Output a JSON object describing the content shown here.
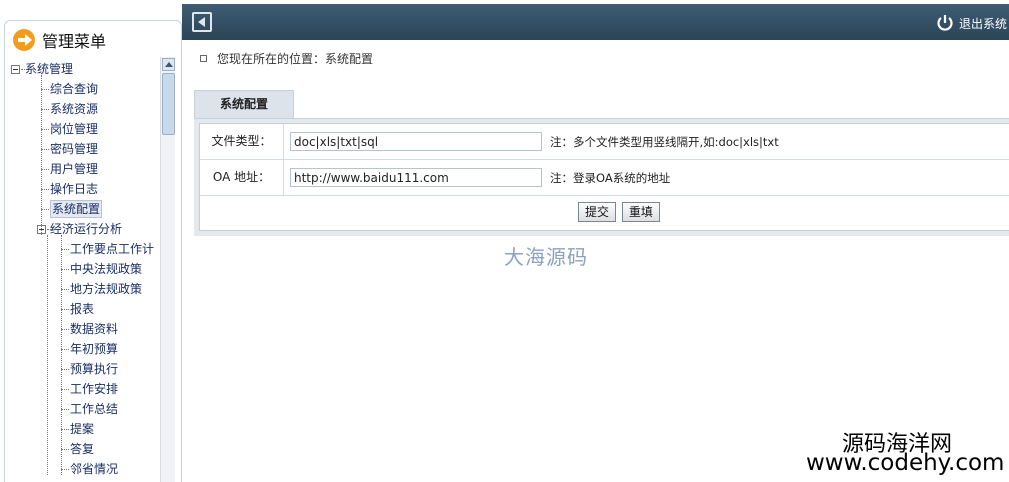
{
  "header": {
    "logout_label": "退出系统"
  },
  "sidebar": {
    "title": "管理菜单",
    "root": "系统管理",
    "system_items": [
      "综合查询",
      "系统资源",
      "岗位管理",
      "密码管理",
      "用户管理",
      "操作日志",
      "系统配置"
    ],
    "selected_item": "系统配置",
    "group": "经济运行分析",
    "group_items": [
      "工作要点工作计",
      "中央法规政策",
      "地方法规政策",
      "报表",
      "数据资料",
      "年初预算",
      "预算执行",
      "工作安排",
      "工作总结",
      "提案",
      "答复",
      "邻省情况"
    ]
  },
  "breadcrumb": {
    "text": "您现在所在的位置：系统配置"
  },
  "tab": {
    "label": "系统配置"
  },
  "form": {
    "file_type_label": "文件类型：",
    "file_type_value": "doc|xls|txt|sql",
    "file_type_note": "注：多个文件类型用竖线隔开,如:doc|xls|txt",
    "oa_label": "OA 地址：",
    "oa_value": "http://www.baidu111.com",
    "oa_note": "注：登录OA系统的地址",
    "submit_label": "提交",
    "reset_label": "重填"
  },
  "watermarks": {
    "center": "大海源码",
    "bottom_line1": "源码海洋网",
    "bottom_line2": "www.codehy.com"
  },
  "colors": {
    "topbar": "#34506a",
    "tree_text": "#1a2f66",
    "menu_icon": "#f19c1c"
  },
  "icons": {
    "menu": "arrow-right-circle-icon",
    "logout": "power-icon",
    "sidebar_toggle": "collapse-left-icon"
  }
}
